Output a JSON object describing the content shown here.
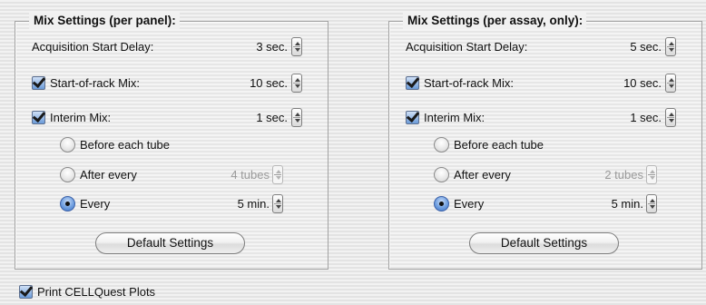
{
  "left_panel": {
    "title": "Mix Settings (per panel):",
    "acquisition_delay_label": "Acquisition Start Delay:",
    "acquisition_delay_value": "3 sec.",
    "start_of_rack_label": "Start-of-rack Mix:",
    "start_of_rack_value": "10 sec.",
    "start_of_rack_checked": true,
    "interim_label": "Interim Mix:",
    "interim_value": "1 sec.",
    "interim_checked": true,
    "before_each_label": "Before each tube",
    "after_every_label": "After every",
    "after_every_value": "4 tubes",
    "every_label": "Every",
    "every_value": "5 min.",
    "selected_option": "every",
    "default_button": "Default Settings"
  },
  "right_panel": {
    "title": "Mix Settings (per assay, only):",
    "acquisition_delay_label": "Acquisition Start Delay:",
    "acquisition_delay_value": "5 sec.",
    "start_of_rack_label": "Start-of-rack Mix:",
    "start_of_rack_value": "10 sec.",
    "start_of_rack_checked": true,
    "interim_label": "Interim Mix:",
    "interim_value": "1 sec.",
    "interim_checked": true,
    "before_each_label": "Before each tube",
    "after_every_label": "After every",
    "after_every_value": "2 tubes",
    "every_label": "Every",
    "every_value": "5 min.",
    "selected_option": "every",
    "default_button": "Default Settings"
  },
  "print_plots": {
    "label": "Print CELLQuest Plots",
    "checked": true
  },
  "colors": {
    "accent": "#3f74c6",
    "disabled_text": "#9a9a9a"
  }
}
